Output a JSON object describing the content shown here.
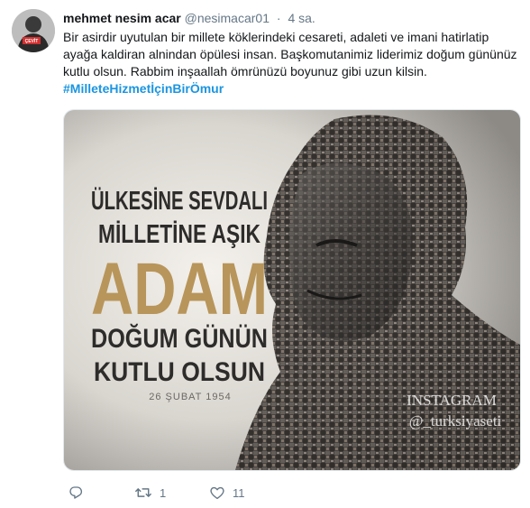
{
  "tweet": {
    "author_name": "mehmet nesim acar",
    "author_handle": "@nesimacar01",
    "separator": "·",
    "time": "4 sa.",
    "text": "Bir asirdir uyutulan bir millete köklerindeki cesareti, adaleti ve imani hatirlatip ayağa kaldiran alnindan öpülesi insan. Başkomutanimiz liderimiz doğum gününüz kutlu olsun. Rabbim inşaallah ömrünüzü boyunuz gibi uzun kilsin.",
    "hashtag": "#MilleteHizmetİçinBirÖmur",
    "avatar_badge": "ÇEVİT"
  },
  "media": {
    "line1": "ÜLKESİNE SEVDALI",
    "line2": "MİLLETİNE AŞIK",
    "line3": "ADAM",
    "line4": "DOĞUM GÜNÜN",
    "line5": "KUTLU OLSUN",
    "date": "26 ŞUBAT 1954",
    "watermark_title": "INSTAGRAM",
    "watermark_handle": "@_turksiyaseti",
    "accent_color": "#b8955a"
  },
  "actions": {
    "reply_icon": "reply-icon",
    "retweet_icon": "retweet-icon",
    "retweet_count": "1",
    "like_icon": "heart-icon",
    "like_count": "11"
  }
}
